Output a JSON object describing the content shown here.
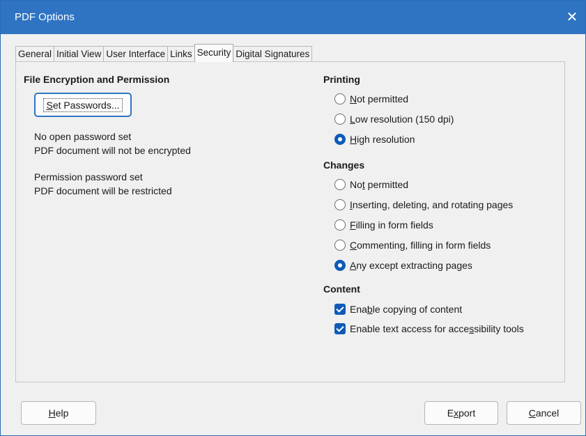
{
  "window": {
    "title": "PDF Options",
    "close_glyph": "✕"
  },
  "tabs": [
    {
      "label": "General"
    },
    {
      "label": "Initial View"
    },
    {
      "label": "User Interface"
    },
    {
      "label": "Links"
    },
    {
      "label": "Security",
      "active": true
    },
    {
      "label": "Digital Signatures"
    }
  ],
  "encryption": {
    "heading": "File Encryption and Permission",
    "set_passwords": {
      "pre": "",
      "accel": "S",
      "post": "et Passwords..."
    },
    "open_status_1": "No open password set",
    "open_status_2": "PDF document will not be encrypted",
    "perm_status_1": "Permission password set",
    "perm_status_2": "PDF document will be restricted"
  },
  "printing": {
    "heading": "Printing",
    "options": [
      {
        "pre": "",
        "accel": "N",
        "post": "ot permitted",
        "selected": false
      },
      {
        "pre": "",
        "accel": "L",
        "post": "ow resolution (150 dpi)",
        "selected": false
      },
      {
        "pre": "",
        "accel": "H",
        "post": "igh resolution",
        "selected": true
      }
    ]
  },
  "changes": {
    "heading": "Changes",
    "options": [
      {
        "pre": "No",
        "accel": "t",
        "post": " permitted",
        "selected": false
      },
      {
        "pre": "",
        "accel": "I",
        "post": "nserting, deleting, and rotating pages",
        "selected": false
      },
      {
        "pre": "",
        "accel": "F",
        "post": "illing in form fields",
        "selected": false
      },
      {
        "pre": "",
        "accel": "C",
        "post": "ommenting, filling in form fields",
        "selected": false
      },
      {
        "pre": "",
        "accel": "A",
        "post": "ny except extracting pages",
        "selected": true
      }
    ]
  },
  "content": {
    "heading": "Content",
    "options": [
      {
        "pre": "Ena",
        "accel": "b",
        "post": "le copying of content",
        "checked": true
      },
      {
        "pre": "Enable text access for acce",
        "accel": "s",
        "post": "sibility tools",
        "checked": true
      }
    ]
  },
  "footer": {
    "help": {
      "pre": "",
      "accel": "H",
      "post": "elp"
    },
    "export": {
      "pre": "E",
      "accel": "x",
      "post": "port"
    },
    "cancel": {
      "pre": "",
      "accel": "C",
      "post": "ancel"
    }
  },
  "colors": {
    "titlebar": "#2f74c2",
    "accent": "#0f5ab8"
  }
}
